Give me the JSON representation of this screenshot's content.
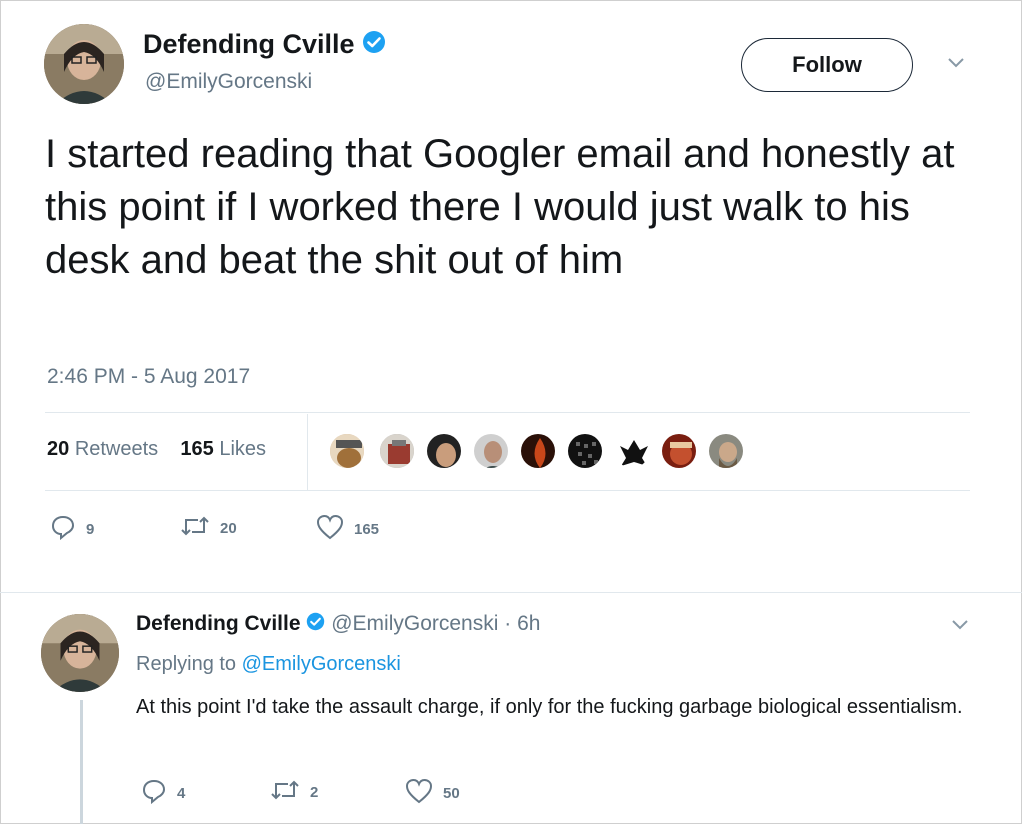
{
  "tweet": {
    "author_name": "Defending Cville",
    "author_handle": "@EmilyGorcenski",
    "follow_label": "Follow",
    "text": "I started reading that Googler email and honestly at this point if I worked there I would just walk to his desk and beat the shit out of him",
    "timestamp": "2:46 PM - 5 Aug 2017",
    "stats": {
      "retweets_count": "20",
      "retweets_label": "Retweets",
      "likes_count": "165",
      "likes_label": "Likes"
    },
    "actions": {
      "reply_count": "9",
      "retweet_count": "20",
      "like_count": "165"
    },
    "liker_avatar_count": 9
  },
  "reply": {
    "author_name": "Defending Cville",
    "author_handle": "@EmilyGorcenski",
    "time": "· 6h",
    "replying_prefix": "Replying to",
    "replying_to": "@EmilyGorcenski",
    "text": "At this point I'd take the assault charge, if only for the fucking garbage biological essentialism.",
    "actions": {
      "reply_count": "4",
      "retweet_count": "2",
      "like_count": "50"
    }
  },
  "icons": [
    "verified-icon",
    "caret-down-icon",
    "reply-icon",
    "retweet-icon",
    "heart-icon"
  ],
  "colors": {
    "verified_blue": "#1da1f2",
    "secondary_text": "#657786",
    "link_blue": "#1b95e0",
    "divider": "#e1e8ed"
  }
}
